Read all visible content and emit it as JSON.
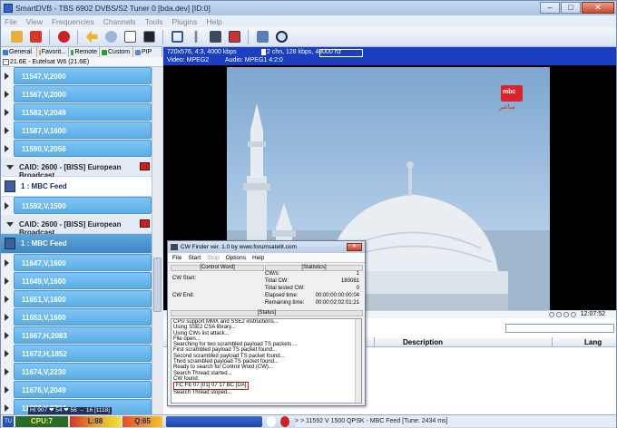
{
  "app": {
    "title": "SmartDVB - TBS 6902 DVBS/S2 Tuner 0 [bda.dev] [ID:0]"
  },
  "window_buttons": {
    "minimize": "–",
    "maximize": "□",
    "close": "✕"
  },
  "menu": [
    "File",
    "View",
    "Frequencies",
    "Channels",
    "Tools",
    "Plugins",
    "Help"
  ],
  "toolbar_icons": [
    "folder-open-icon",
    "delete-icon",
    "record-icon",
    "back-arrow-icon",
    "schedule-icon",
    "list-icon",
    "tv-icon",
    "fullscreen-icon",
    "tools-icon",
    "capture-icon",
    "epg-icon",
    "screen-icon",
    "zoom-icon"
  ],
  "left_tabs": [
    {
      "label": "General",
      "color": "#3a7bd5"
    },
    {
      "label": "Favorit...",
      "color": "#e0a020"
    },
    {
      "label": "Remote",
      "color": "#33aa33"
    },
    {
      "label": "Custom",
      "color": "#2c9c2c"
    },
    {
      "label": "PIP",
      "color": "#5a8bd0"
    }
  ],
  "satellite": "21.6E - Eutelsat W6 (21.6E)",
  "channel_rows": [
    {
      "type": "freq",
      "label": "11547,V,2000"
    },
    {
      "type": "freq",
      "label": "11567,V,2000"
    },
    {
      "type": "freq",
      "label": "11582,V,2049"
    },
    {
      "type": "freq",
      "label": "11587,V,1600"
    },
    {
      "type": "freq",
      "label": "11590,V,2056"
    },
    {
      "type": "caid",
      "label": "CAID: 2600 - [BISS] European Broadcast"
    },
    {
      "type": "chan",
      "label": "1 : MBC Feed",
      "selected": false
    },
    {
      "type": "freq",
      "label": "11592,V,1500"
    },
    {
      "type": "caid",
      "label": "CAID: 2600 - [BISS] European Broadcast"
    },
    {
      "type": "chan",
      "label": "1 : MBC Feed",
      "selected": true
    },
    {
      "type": "freq",
      "label": "11647,V,1600"
    },
    {
      "type": "freq",
      "label": "11649,V,1600"
    },
    {
      "type": "freq",
      "label": "11651,V,1600"
    },
    {
      "type": "freq",
      "label": "11653,V,1600"
    },
    {
      "type": "freq",
      "label": "11667,H,2083"
    },
    {
      "type": "freq",
      "label": "11672,H,1852"
    },
    {
      "type": "freq",
      "label": "11674,V,2230"
    },
    {
      "type": "freq",
      "label": "11676,V,2049"
    },
    {
      "type": "freq",
      "label": "11682,V,2734"
    }
  ],
  "video_info": {
    "line1": "720x576, 4:3, 4000 kbps",
    "line1b": "2 chn, 128 kbps, 48000 hz",
    "video": "Video: MPEG2",
    "audio": "Audio: MPEG1 4:2:0"
  },
  "channel_logo": {
    "text": "مباشر",
    "badge": "mbc"
  },
  "playback": {
    "time": "12:07:52"
  },
  "table_headers": {
    "description": "Description",
    "lang": "Lang"
  },
  "cw_finder": {
    "title": "CW Finder ver. 1.0 by www.forumsatelit.com",
    "close": "✕",
    "menu": [
      {
        "label": "File",
        "disabled": false
      },
      {
        "label": "Start",
        "disabled": false
      },
      {
        "label": "Stop",
        "disabled": true
      },
      {
        "label": "Options",
        "disabled": false
      },
      {
        "label": "Help",
        "disabled": false
      }
    ],
    "sections": {
      "control_word": "[Control Word]",
      "statistics": "[Statistics]",
      "status": "[Status]"
    },
    "labels": {
      "cw_start": "CW Start:",
      "cw_end": "CW End:"
    },
    "stats": [
      {
        "label": "CW/s:",
        "value": "1"
      },
      {
        "label": "Total CW:",
        "value": "180081"
      },
      {
        "label": "Total tested CW:",
        "value": "0"
      },
      {
        "label": "Elapsed time:",
        "value": "00:00:00:00:00:04"
      },
      {
        "label": "Remaining time:",
        "value": "00:00:02:02:01:21"
      }
    ],
    "log": [
      "CPU support MMX and SSE2 instructions...",
      "Using SSE2 CSA library...",
      "Using CWs list attack...",
      "File open...",
      "Searching for two scrambled payload TS packets ...",
      "First scrambled payload TS packet found...",
      "Second scrambled payload TS packet found...",
      "Third scrambled payload TS packet found...",
      "Ready to search for Control Word (CW)...",
      "Search Thread started...",
      "CW found:"
    ],
    "found_cw": "FC FE 07 [01] 07 17 BC [DA]",
    "log_tail": "Search Thread stoped..."
  },
  "statusbar": {
    "tv": "TU",
    "cpu": "CPU:7",
    "signal": "L:88",
    "quality": "Q:65",
    "counts": "HI 907 ❤ 54 ❤ 56 → 16 [1118]",
    "tuned": "> > 11592 V 1500 QPSK - MBC Feed  [Tune: 2434 ms]"
  },
  "colors": {
    "freq_row": "#5aaee8",
    "selected_row": "#3e86c3",
    "video_info_bar": "#1a3fc0",
    "cw_highlight": "#d21a1a"
  }
}
